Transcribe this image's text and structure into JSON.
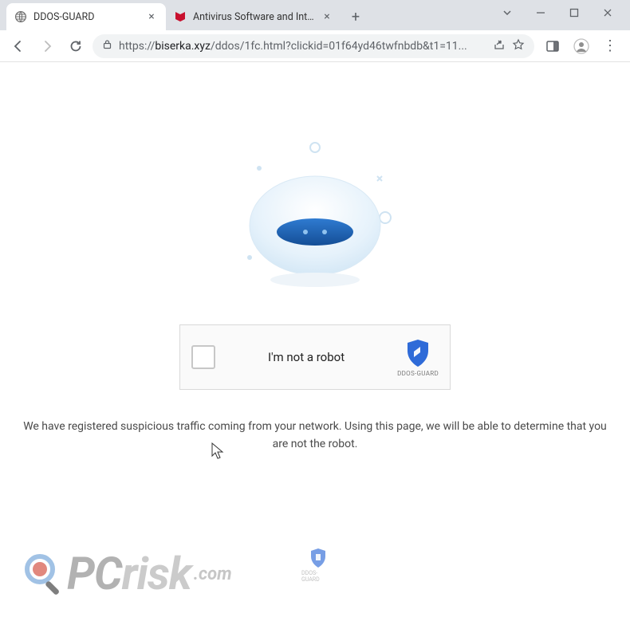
{
  "window": {
    "tabs": [
      {
        "title": "DDOS-GUARD",
        "active": true,
        "favicon": "globe"
      },
      {
        "title": "Antivirus Software and Internet S",
        "active": false,
        "favicon": "mcafee"
      }
    ],
    "controls": {
      "chevron": "v"
    }
  },
  "toolbar": {
    "url_scheme": "https://",
    "url_host": "biserka.xyz",
    "url_path": "/ddos/1fc.html?clickid=01f64yd46twfnbdb&t1=11..."
  },
  "page": {
    "captcha_label": "I'm not a robot",
    "brand_label": "DDOS-GUARD",
    "message": "We have registered suspicious traffic coming from your network. Using this page, we will be able to determine that you are not the robot."
  },
  "watermark": {
    "pc": "PC",
    "risk": "risk",
    "dot_com": ".com",
    "tiny_label": "DDOS-GUARD"
  },
  "colors": {
    "accent": "#2f6bd8",
    "shield": "#2f6bd8",
    "robot_body": "#e8f3fb",
    "robot_visor": "#1b66b5"
  }
}
